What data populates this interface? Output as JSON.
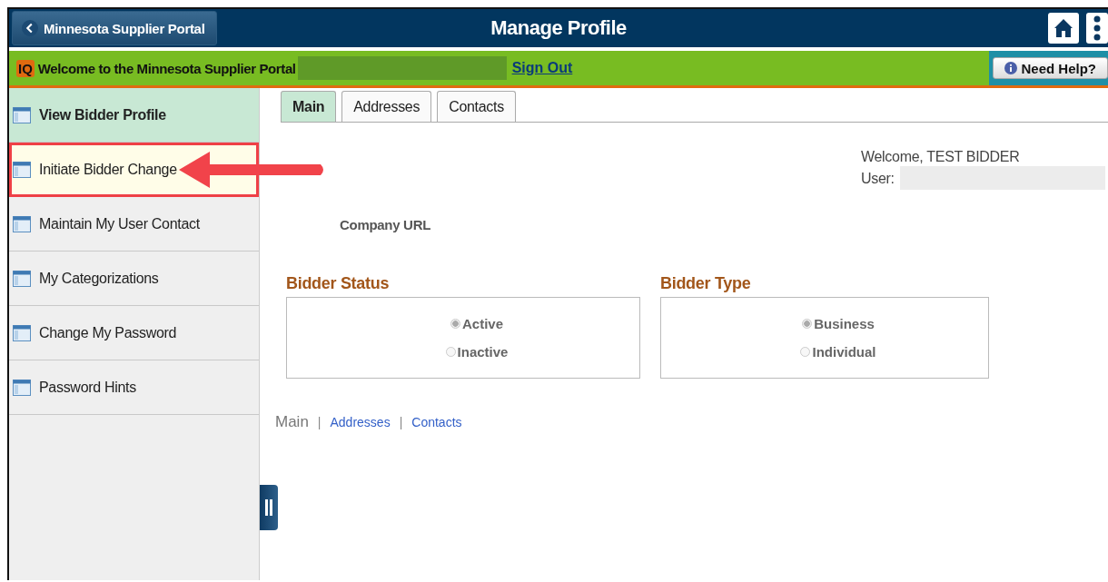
{
  "header": {
    "back_button": "Minnesota Supplier Portal",
    "title": "Manage Profile"
  },
  "banner": {
    "logo": "IQ",
    "welcome": "Welcome to the Minnesota Supplier Portal",
    "sign_out": "Sign Out",
    "help_button": "Need Help?"
  },
  "sidebar": {
    "items": [
      {
        "label": "View Bidder Profile",
        "selected": true,
        "highlighted": false
      },
      {
        "label": "Initiate Bidder Change",
        "selected": false,
        "highlighted": true
      },
      {
        "label": "Maintain My User Contact",
        "selected": false,
        "highlighted": false
      },
      {
        "label": "My Categorizations",
        "selected": false,
        "highlighted": false
      },
      {
        "label": "Change My Password",
        "selected": false,
        "highlighted": false
      },
      {
        "label": "Password Hints",
        "selected": false,
        "highlighted": false
      }
    ]
  },
  "tabs": [
    {
      "label": "Main",
      "selected": true
    },
    {
      "label": "Addresses",
      "selected": false
    },
    {
      "label": "Contacts",
      "selected": false
    }
  ],
  "user_info": {
    "welcome": "Welcome, TEST BIDDER",
    "user_label": "User:"
  },
  "company_url_label": "Company URL",
  "groups": [
    {
      "title": "Bidder Status",
      "options": [
        {
          "label": "Active",
          "selected": true
        },
        {
          "label": "Inactive",
          "selected": false
        }
      ]
    },
    {
      "title": "Bidder Type",
      "options": [
        {
          "label": "Business",
          "selected": true
        },
        {
          "label": "Individual",
          "selected": false
        }
      ]
    }
  ],
  "bottom_links": [
    {
      "label": "Main",
      "current": true,
      "separator": "|"
    },
    {
      "label": "Addresses",
      "current": false,
      "separator": "|"
    },
    {
      "label": "Contacts",
      "current": false
    }
  ]
}
